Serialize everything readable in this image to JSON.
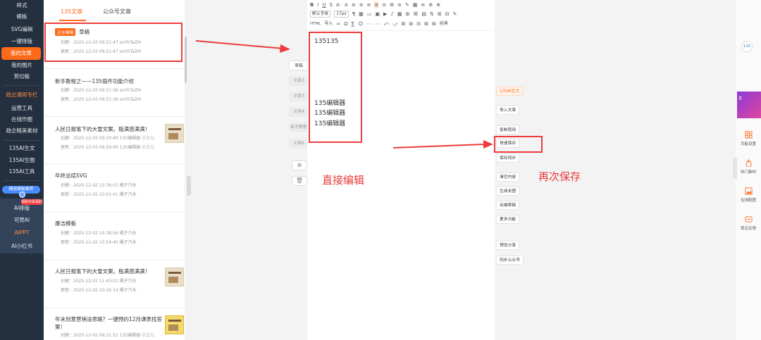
{
  "nav": {
    "items": [
      "样式",
      "模板",
      "SVG编辑",
      "一键排版",
      "我的文章",
      "我的图片",
      "剪切板",
      "政企通用专栏",
      "运营工具",
      "在线作图",
      "政企精美素材",
      "135AI生文",
      "135AI生图",
      "135AI工具",
      "AI排版",
      "可赞AI",
      "AIPPT",
      "AI小红书"
    ],
    "badge": "精选模板推荐",
    "tiny_badge": "领取专属福利"
  },
  "list": {
    "tabs": [
      "135文章",
      "公众号文章"
    ],
    "articles": [
      {
        "status": "正在编辑",
        "title": "草稿",
        "created": "创建：2025-12-03 09:31:47  oeYhTaZM",
        "updated": "更新：2025-12-03 09:31:47  oeYhTaZM"
      },
      {
        "title": "新手教程之——135插件功能介绍",
        "created": "创建：2025-12-03 09:31:36  oeYhTaZM",
        "updated": "更新：2025-12-03 09:31:36  oeYhTaZM"
      },
      {
        "title": "人民日报笔下的大雪文案。瓶满感满满！",
        "created": "创建：2025-12-03 09:29:40  135编辑器 小三儿",
        "updated": "更新：2025-12-03 09:29:40  135编辑器 小三儿"
      },
      {
        "title": "年终总结SVG",
        "created": "创建：2025-12-02 15:38:01  橘子汽水",
        "updated": "更新：2025-12-02 22:01:41  橘子汽水"
      },
      {
        "title": "廉洁模板",
        "created": "创建：2025-12-02 10:38:56  橘子汽水",
        "updated": "更新：2025-12-02 10:54:40  橘子汽水"
      },
      {
        "title": "人民日报笔下的大雪文案。瓶满感满满！",
        "created": "创建：2025-12-01 11:43:01  橘子汽水",
        "updated": "更新：2025-12-02 20:26:14  橘子汽水"
      },
      {
        "title": "年末创意营销没思路？一键预约12月课表找答",
        "title2": "案！",
        "created": "创建：2025-12-01 09:31:52  135编辑器 小三儿"
      }
    ]
  },
  "pages": {
    "tabs": [
      "草稿",
      "文章2",
      "文章3",
      "文章4",
      "新手教程",
      "文章6"
    ],
    "add_icon": "⊕",
    "delete_icon": "🗑"
  },
  "toolbar": {
    "row1": [
      "B",
      "I",
      "U",
      "S",
      "A·",
      "A",
      "≡",
      "≡",
      "≡",
      "≡",
      "≡",
      "⊞",
      "≡",
      "✎",
      "▦",
      "≡",
      "⊕",
      "⊕"
    ],
    "font_select": "默认字体",
    "size_select": "17px",
    "row2": [
      "¶",
      "▦",
      "▭",
      "▣",
      "▶",
      "♪",
      "▦",
      "⊞",
      "⌘",
      "▤",
      "⇅",
      "⊞",
      "⊟",
      "✎"
    ],
    "html_label": "HTML",
    "import_label": "导入",
    "row3": [
      "∞",
      "Ω",
      "∑",
      "☺",
      "⋯",
      "⋯",
      "⤺",
      "⤻",
      "⊞",
      "⊞",
      "⊟",
      "⊞",
      "⊞"
    ],
    "classic_label": "经典"
  },
  "editor": {
    "lines": [
      "135135",
      "135编辑器",
      "135编辑器",
      "135编辑器"
    ]
  },
  "actions": {
    "ai_label": "135AI生文",
    "buttons": [
      "导入文章",
      "复制使用",
      "快速保存",
      "保存同步",
      "清空内容",
      "生成长图",
      "云端草稿",
      "更多功能",
      "预览分享",
      "同步公众号"
    ]
  },
  "annotations": {
    "edit_directly": "直接编辑",
    "save_again": "再次保存"
  },
  "right_bar": {
    "logo": "135",
    "promo_text": "直",
    "items": [
      "功能设置",
      "热门素材",
      "在线配图",
      "意见反馈"
    ]
  },
  "colors": {
    "accent": "#ff6a1a",
    "annotation": "#ee3b3b",
    "nav_bg": "#24303f"
  }
}
